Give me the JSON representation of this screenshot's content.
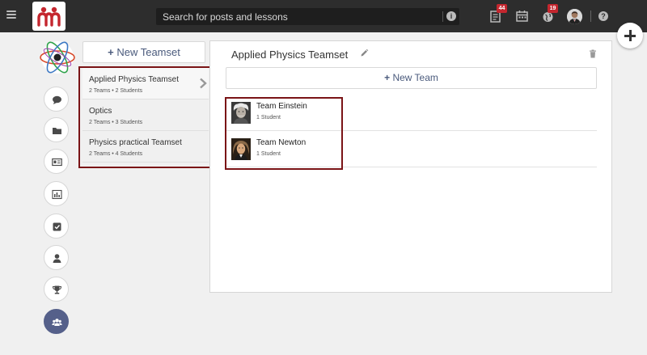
{
  "app": {
    "search_placeholder": "Search for posts and lessons"
  },
  "topbar": {
    "notifications_badge": "44",
    "globe_badge": "19"
  },
  "teamsets": {
    "new_button": "New Teamset",
    "items": [
      {
        "title": "Applied Physics Teamset",
        "meta": "2 Teams • 2 Students",
        "active": true
      },
      {
        "title": "Optics",
        "meta": "2 Teams • 3 Students",
        "active": false
      },
      {
        "title": "Physics practical Teamset",
        "meta": "2 Teams • 4 Students",
        "active": false
      }
    ]
  },
  "panel": {
    "title": "Applied Physics Teamset",
    "new_team_button": "New Team",
    "teams": [
      {
        "name": "Team Einstein",
        "count": "1 Student"
      },
      {
        "name": "Team Newton",
        "count": "1 Student"
      }
    ]
  },
  "colors": {
    "topbar": "#2d2d2d",
    "accent": "#4a5a7c",
    "highlight": "#7a1416",
    "active_rail": "#55608a",
    "badge": "#c4262e"
  },
  "icons": {
    "rail": [
      "chat-icon",
      "folder-icon",
      "id-card-icon",
      "bar-chart-icon",
      "checkbox-icon",
      "user-icon",
      "trophy-icon",
      "group-icon"
    ]
  }
}
